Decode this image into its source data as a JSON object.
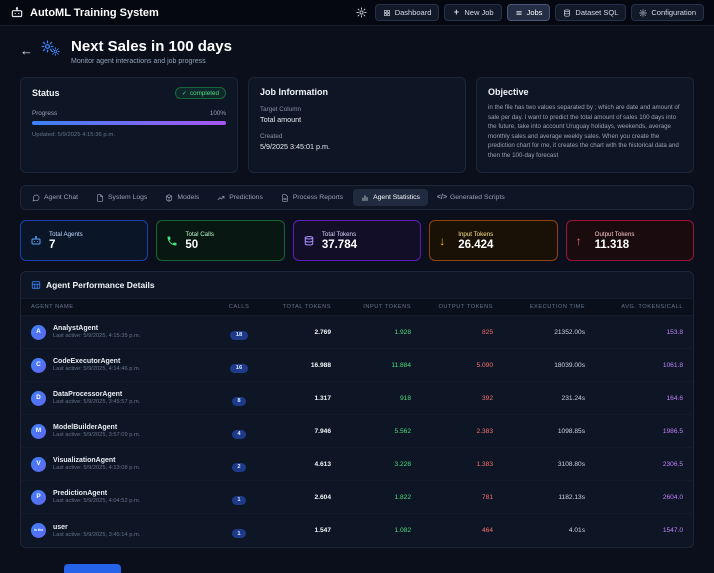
{
  "topbar": {
    "title": "AutoML Training System",
    "nav": [
      {
        "label": "Dashboard",
        "icon": "dashboard-grid-icon",
        "active": false
      },
      {
        "label": "New Job",
        "icon": "plus-icon",
        "active": false
      },
      {
        "label": "Jobs",
        "icon": "list-icon",
        "active": true
      },
      {
        "label": "Dataset SQL",
        "icon": "database-icon",
        "active": false
      },
      {
        "label": "Configuration",
        "icon": "gear-icon",
        "active": false
      }
    ]
  },
  "header": {
    "back": "←",
    "title": "Next Sales in 100 days",
    "subtitle": "Monitor agent interactions and job progress"
  },
  "status_card": {
    "title": "Status",
    "badge": "completed",
    "progress_label": "Progress",
    "progress_value": "100%",
    "updated": "Updated: 5/9/2025 4:15:36 p.m."
  },
  "job_card": {
    "title": "Job Information",
    "target_column_label": "Target Column",
    "target_column_value": "Total amount",
    "created_label": "Created",
    "created_value": "5/9/2025 3:45:01 p.m."
  },
  "objective_card": {
    "title": "Objective",
    "text": "in the file has two values separated by ; which are date and amount of sale per day. I want to predict the total amount of sales 100 days into the future, take into account Uruguay holidays, weekends, average monthly sales and average weekly sales. When you create the prediction chart for me, it creates the chart with the historical data and then the 100-day forecast"
  },
  "tabs": [
    {
      "label": "Agent Chat",
      "icon": "chat-icon",
      "active": false
    },
    {
      "label": "System Logs",
      "icon": "document-icon",
      "active": false
    },
    {
      "label": "Models",
      "icon": "cube-icon",
      "active": false
    },
    {
      "label": "Predictions",
      "icon": "trend-icon",
      "active": false
    },
    {
      "label": "Process Reports",
      "icon": "report-icon",
      "active": false
    },
    {
      "label": "Agent Statistics",
      "icon": "bar-chart-icon",
      "active": true
    },
    {
      "label": "Generated Scripts",
      "icon": "code-icon",
      "active": false
    }
  ],
  "stats": [
    {
      "label": "Total Agents",
      "value": "7",
      "icon": "robot-icon",
      "accent": "#60a5fa",
      "label_color": "#bfdbfe",
      "bg": "#0b1528",
      "border": "#1e40af"
    },
    {
      "label": "Total Calls",
      "value": "50",
      "icon": "phone-icon",
      "accent": "#4ade80",
      "label_color": "#bbf7d0",
      "bg": "#081711",
      "border": "#166534"
    },
    {
      "label": "Total Tokens",
      "value": "37.784",
      "icon": "coins-icon",
      "accent": "#a78bfa",
      "label_color": "#ddd6fe",
      "bg": "#130e28",
      "border": "#5b21b6"
    },
    {
      "label": "Input Tokens",
      "value": "26.424",
      "icon": "arrow-down-icon",
      "accent": "#fbbf24",
      "label_color": "#fde68a",
      "bg": "#1a1106",
      "border": "#92400e"
    },
    {
      "label": "Output Tokens",
      "value": "11.318",
      "icon": "arrow-up-icon",
      "accent": "#f87171",
      "label_color": "#fecaca",
      "bg": "#1a0b0e",
      "border": "#9f1239"
    }
  ],
  "table": {
    "title": "Agent Performance Details",
    "columns": [
      "Agent Name",
      "Calls",
      "Total Tokens",
      "Input Tokens",
      "Output Tokens",
      "Execution Time",
      "Avg. Tokens/Call"
    ],
    "rows": [
      {
        "avatar": "A",
        "name": "AnalystAgent",
        "last_active": "Last active: 5/9/2025, 4:15:35 p.m.",
        "calls": "18",
        "total_tokens": "2.769",
        "input_tokens": "1.928",
        "output_tokens": "825",
        "execution_time": "21352.00s",
        "avg_tokens_per_call": "153.8"
      },
      {
        "avatar": "C",
        "name": "CodeExecutorAgent",
        "last_active": "Last active: 5/9/2025, 4:14:46 p.m.",
        "calls": "16",
        "total_tokens": "16.988",
        "input_tokens": "11.884",
        "output_tokens": "5.090",
        "execution_time": "18039.00s",
        "avg_tokens_per_call": "1061.8"
      },
      {
        "avatar": "D",
        "name": "DataProcessorAgent",
        "last_active": "Last active: 5/9/2025, 3:45:57 p.m.",
        "calls": "8",
        "total_tokens": "1.317",
        "input_tokens": "918",
        "output_tokens": "392",
        "execution_time": "231.24s",
        "avg_tokens_per_call": "164.6"
      },
      {
        "avatar": "M",
        "name": "ModelBuilderAgent",
        "last_active": "Last active: 5/9/2025, 3:57:09 p.m.",
        "calls": "4",
        "total_tokens": "7.946",
        "input_tokens": "5.562",
        "output_tokens": "2.383",
        "execution_time": "1098.85s",
        "avg_tokens_per_call": "1986.5"
      },
      {
        "avatar": "V",
        "name": "VisualizationAgent",
        "last_active": "Last active: 5/9/2025, 4:13:08 p.m.",
        "calls": "2",
        "total_tokens": "4.613",
        "input_tokens": "3.228",
        "output_tokens": "1.383",
        "execution_time": "3108.80s",
        "avg_tokens_per_call": "2306.5"
      },
      {
        "avatar": "P",
        "name": "PredictionAgent",
        "last_active": "Last active: 5/9/2025, 4:04:52 p.m.",
        "calls": "1",
        "total_tokens": "2.604",
        "input_tokens": "1.822",
        "output_tokens": "781",
        "execution_time": "1182.13s",
        "avg_tokens_per_call": "2604.0"
      },
      {
        "avatar": "in the",
        "name": "user",
        "last_active": "Last active: 5/9/2025, 3:45:14 p.m.",
        "calls": "1",
        "total_tokens": "1.547",
        "input_tokens": "1.082",
        "output_tokens": "464",
        "execution_time": "4.01s",
        "avg_tokens_per_call": "1547.0"
      }
    ]
  }
}
